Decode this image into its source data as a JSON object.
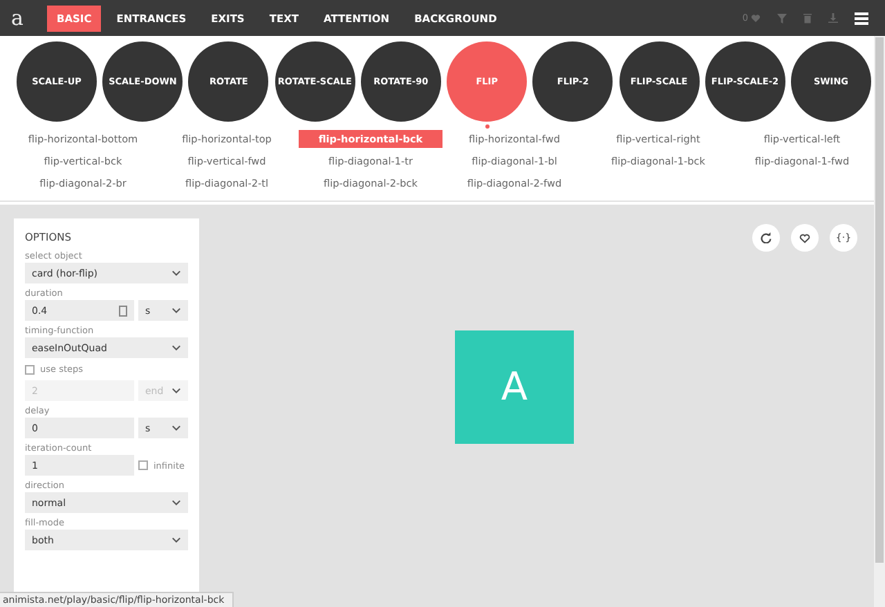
{
  "nav": {
    "logo": "a",
    "tabs": [
      {
        "label": "BASIC",
        "selected": true
      },
      {
        "label": "ENTRANCES",
        "selected": false
      },
      {
        "label": "EXITS",
        "selected": false
      },
      {
        "label": "TEXT",
        "selected": false
      },
      {
        "label": "ATTENTION",
        "selected": false
      },
      {
        "label": "BACKGROUND",
        "selected": false
      }
    ],
    "like_count": "0"
  },
  "animations": [
    {
      "label": "SCALE-UP",
      "selected": false
    },
    {
      "label": "SCALE-DOWN",
      "selected": false
    },
    {
      "label": "ROTATE",
      "selected": false
    },
    {
      "label": "ROTATE-SCALE",
      "selected": false
    },
    {
      "label": "ROTATE-90",
      "selected": false
    },
    {
      "label": "FLIP",
      "selected": true
    },
    {
      "label": "FLIP-2",
      "selected": false
    },
    {
      "label": "FLIP-SCALE",
      "selected": false
    },
    {
      "label": "FLIP-SCALE-2",
      "selected": false
    },
    {
      "label": "SWING",
      "selected": false
    }
  ],
  "variants": [
    {
      "label": "flip-horizontal-bottom",
      "selected": false
    },
    {
      "label": "flip-horizontal-top",
      "selected": false
    },
    {
      "label": "flip-horizontal-bck",
      "selected": true
    },
    {
      "label": "flip-horizontal-fwd",
      "selected": false
    },
    {
      "label": "flip-vertical-right",
      "selected": false
    },
    {
      "label": "flip-vertical-left",
      "selected": false
    },
    {
      "label": "flip-vertical-bck",
      "selected": false
    },
    {
      "label": "flip-vertical-fwd",
      "selected": false
    },
    {
      "label": "flip-diagonal-1-tr",
      "selected": false
    },
    {
      "label": "flip-diagonal-1-bl",
      "selected": false
    },
    {
      "label": "flip-diagonal-1-bck",
      "selected": false
    },
    {
      "label": "flip-diagonal-1-fwd",
      "selected": false
    },
    {
      "label": "flip-diagonal-2-br",
      "selected": false
    },
    {
      "label": "flip-diagonal-2-tl",
      "selected": false
    },
    {
      "label": "flip-diagonal-2-bck",
      "selected": false
    },
    {
      "label": "flip-diagonal-2-fwd",
      "selected": false
    }
  ],
  "options": {
    "title": "OPTIONS",
    "fields": [
      {
        "kind": "select",
        "label": "select object",
        "value": "card (hor-flip)"
      },
      {
        "kind": "unit",
        "label": "duration",
        "value": "0.4",
        "unit": "s",
        "spinner": true
      },
      {
        "kind": "select",
        "label": "timing-function",
        "value": "easeInOutQuad"
      },
      {
        "kind": "checkbox",
        "label": "use steps",
        "checked": false
      },
      {
        "kind": "steps",
        "value": "2",
        "unit": "end",
        "disabled": true
      },
      {
        "kind": "unit",
        "label": "delay",
        "value": "0",
        "unit": "s",
        "spinner": false
      },
      {
        "kind": "count",
        "label": "iteration-count",
        "value": "1",
        "option": "infinite",
        "checked": false
      },
      {
        "kind": "select",
        "label": "direction",
        "value": "normal"
      },
      {
        "kind": "select",
        "label": "fill-mode",
        "value": "both"
      }
    ]
  },
  "preview": {
    "code_button": "{·}",
    "card_letter": "A"
  },
  "status_url": "animista.net/play/basic/flip/flip-horizontal-bck"
}
